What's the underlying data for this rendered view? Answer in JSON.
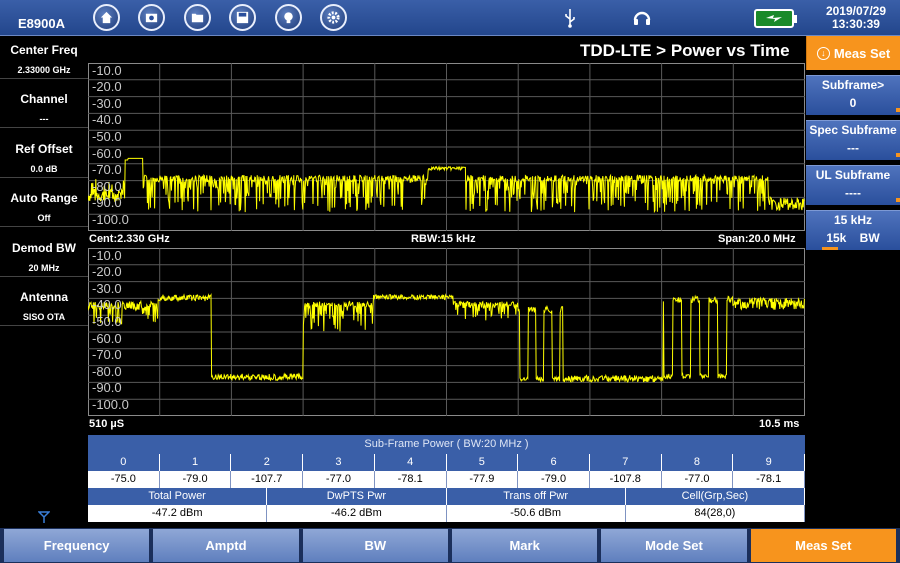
{
  "device": "E8900A",
  "datetime": {
    "date": "2019/07/29",
    "time": "13:30:39"
  },
  "toolbar_icons": [
    "home-icon",
    "camera-folder-icon",
    "folder-icon",
    "save-icon",
    "bulb-icon",
    "gear-icon"
  ],
  "status_icons": [
    "usb-icon",
    "headset-icon",
    "battery-icon"
  ],
  "title": "TDD-LTE > Power vs Time",
  "left_params": [
    {
      "label": "Center Freq",
      "value": "2.33000 GHz"
    },
    {
      "label": "Channel",
      "value": "---"
    },
    {
      "label": "Ref Offset",
      "value": "0.0 dB"
    },
    {
      "label": "Auto Range",
      "value": "Off"
    },
    {
      "label": "Demod BW",
      "value": "20 MHz"
    },
    {
      "label": "Antenna",
      "value": "SISO OTA"
    }
  ],
  "plot1": {
    "y_ticks": [
      "-10.0",
      "-20.0",
      "-30.0",
      "-40.0",
      "-50.0",
      "-60.0",
      "-70.0",
      "-80.0",
      "-90.0",
      "-100.0"
    ],
    "center": "Cent:2.330 GHz",
    "rbw": "RBW:15 kHz",
    "span": "Span:20.0 MHz"
  },
  "plot2": {
    "y_ticks": [
      "-10.0",
      "-20.0",
      "-30.0",
      "-40.0",
      "-50.0",
      "-60.0",
      "-70.0",
      "-80.0",
      "-90.0",
      "-100.0"
    ],
    "start": "510 µS",
    "stop": "10.5 ms"
  },
  "table": {
    "title": "Sub-Frame Power ( BW:20 MHz )",
    "subframes": [
      "0",
      "1",
      "2",
      "3",
      "4",
      "5",
      "6",
      "7",
      "8",
      "9"
    ],
    "powers": [
      "-75.0",
      "-79.0",
      "-107.7",
      "-77.0",
      "-78.1",
      "-77.9",
      "-79.0",
      "-107.8",
      "-77.0",
      "-78.1"
    ],
    "summary_headers": [
      "Total Power",
      "DwPTS Pwr",
      "Trans off Pwr",
      "Cell(Grp,Sec)"
    ],
    "summary_values": [
      "-47.2 dBm",
      "-46.2 dBm",
      "-50.6 dBm",
      "84(28,0)"
    ]
  },
  "right_panel": {
    "header": "Meas Set",
    "items": [
      {
        "label": "Subframe>",
        "value": "0"
      },
      {
        "label": "Spec Subframe",
        "value": "---"
      },
      {
        "label": "UL Subframe",
        "value": "----"
      },
      {
        "label": "15 kHz",
        "value": "15k    BW"
      }
    ]
  },
  "bottom_tabs": [
    "Frequency",
    "Amptd",
    "BW",
    "Mark",
    "Mode Set",
    "Meas Set"
  ],
  "active_tab": "Meas Set",
  "colors": {
    "trace": "#ffff00",
    "accent": "#f7941d",
    "panel": "#3a5fa8"
  }
}
